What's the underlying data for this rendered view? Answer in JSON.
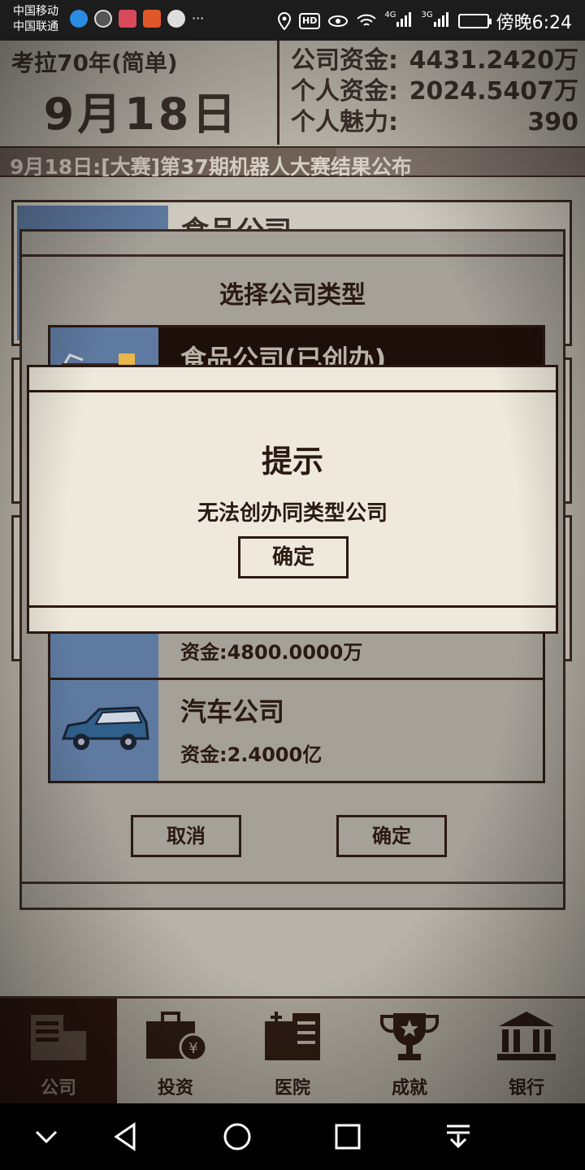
{
  "status_bar": {
    "carrier_1": "中国移动",
    "carrier_2": "中国联通",
    "dots": "···",
    "hd": "HD",
    "net_4g": "4G",
    "net_3g": "3G",
    "time": "傍晚6:24"
  },
  "header": {
    "game_name": "考拉70年(简单)",
    "date": "9月18日",
    "stats": [
      {
        "label": "公司资金:",
        "value": "4431.2420万"
      },
      {
        "label": "个人资金:",
        "value": "2024.5407万"
      },
      {
        "label": "个人魅力:",
        "value": "390"
      }
    ],
    "ticker": "9月18日:[大赛]第37期机器人大赛结果公布"
  },
  "background_card": {
    "name": "食品公司"
  },
  "select_dialog": {
    "title": "选择公司类型",
    "options": [
      {
        "name": "食品公司(已创办)",
        "fund": ""
      },
      {
        "name": "",
        "fund": "资金:4800.0000万"
      },
      {
        "name": "汽车公司",
        "fund": "资金:2.4000亿"
      }
    ],
    "cancel_label": "取消",
    "confirm_label": "确定"
  },
  "tip_dialog": {
    "title": "提示",
    "message": "无法创办同类型公司",
    "confirm_label": "确定"
  },
  "bottom_nav": {
    "active": "公司",
    "items": [
      {
        "label": "公司",
        "icon": "building-icon"
      },
      {
        "label": "投资",
        "icon": "briefcase-yen-icon"
      },
      {
        "label": "医院",
        "icon": "hospital-icon"
      },
      {
        "label": "成就",
        "icon": "trophy-icon"
      },
      {
        "label": "银行",
        "icon": "bank-icon"
      }
    ]
  },
  "system_nav": {
    "icons": [
      "chevron-down-icon",
      "back-icon",
      "home-icon",
      "recents-icon",
      "notification-pull-icon"
    ]
  },
  "colors": {
    "dialog_bg": "#efe9dd",
    "dark_brown": "#2b1a12",
    "thumb_blue": "#5e7aa0",
    "dim_bg": "#b8b3a8"
  }
}
